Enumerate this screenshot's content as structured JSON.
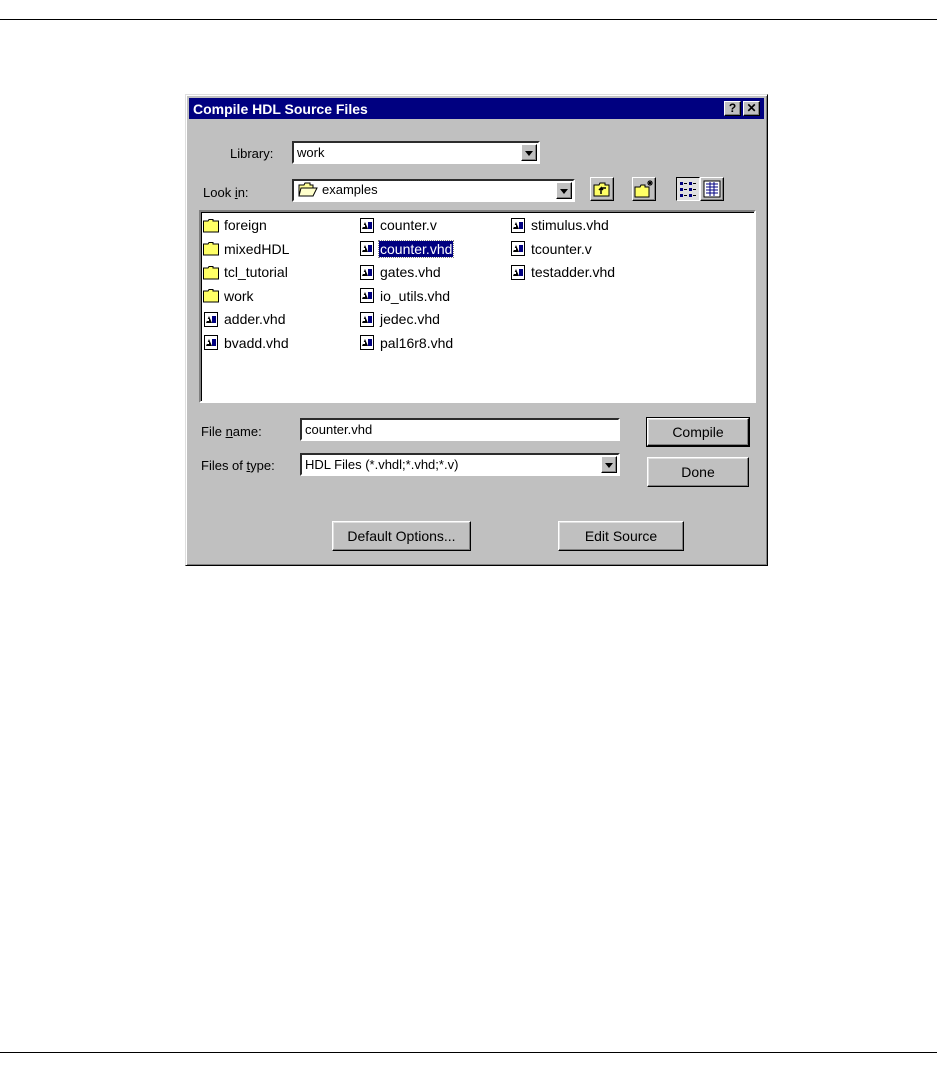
{
  "dialog": {
    "title": "Compile HDL Source Files",
    "help_button": "?",
    "close_button": "✕",
    "library": {
      "label_pre": "Library:",
      "value": "work"
    },
    "look_in": {
      "label_pre": "Look ",
      "label_u": "i",
      "label_post": "n:",
      "value": "examples"
    },
    "files": {
      "col1": [
        {
          "name": "foreign",
          "kind": "folder"
        },
        {
          "name": "mixedHDL",
          "kind": "folder"
        },
        {
          "name": "tcl_tutorial",
          "kind": "folder"
        },
        {
          "name": "work",
          "kind": "folder"
        },
        {
          "name": "adder.vhd",
          "kind": "file"
        },
        {
          "name": "bvadd.vhd",
          "kind": "file"
        }
      ],
      "col2": [
        {
          "name": "counter.v",
          "kind": "file"
        },
        {
          "name": "counter.vhd",
          "kind": "file",
          "selected": true
        },
        {
          "name": "gates.vhd",
          "kind": "file"
        },
        {
          "name": "io_utils.vhd",
          "kind": "file"
        },
        {
          "name": "jedec.vhd",
          "kind": "file"
        },
        {
          "name": "pal16r8.vhd",
          "kind": "file"
        }
      ],
      "col3": [
        {
          "name": "stimulus.vhd",
          "kind": "file"
        },
        {
          "name": "tcounter.v",
          "kind": "file"
        },
        {
          "name": "testadder.vhd",
          "kind": "file"
        }
      ]
    },
    "file_name": {
      "label_pre": "File ",
      "label_u": "n",
      "label_post": "ame:",
      "value": "counter.vhd"
    },
    "files_of_type": {
      "label_pre": "Files of ",
      "label_u": "t",
      "label_post": "ype:",
      "value": "HDL Files (*.vhdl;*.vhd;*.v)"
    },
    "buttons": {
      "compile": "Compile",
      "done": "Done",
      "default_options": "Default Options...",
      "edit_source": "Edit Source"
    }
  },
  "colors": {
    "titlebar": "#000080",
    "face": "#c0c0c0",
    "selection": "#000080"
  },
  "icons": {
    "up_folder": "up-folder-icon",
    "new_folder": "new-folder-icon",
    "list_view": "list-view-icon",
    "details_view": "details-view-icon"
  }
}
